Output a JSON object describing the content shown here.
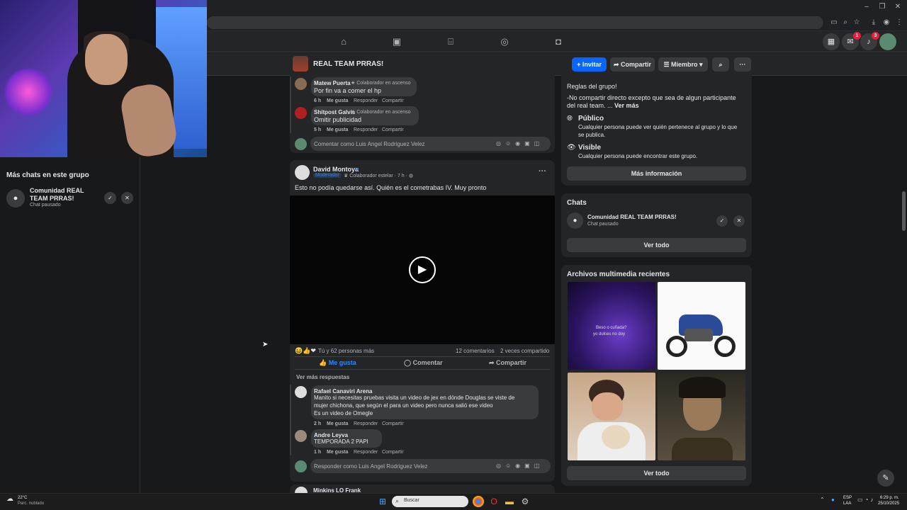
{
  "group": {
    "name": "REAL TEAM PRRAS!",
    "invite": "Invitar",
    "share": "Compartir",
    "member": "Miembro"
  },
  "badges": {
    "messenger": "1",
    "notifications": "3"
  },
  "sidebar": {
    "title": "Más chats en este grupo",
    "chat_name": "Comunidad REAL TEAM PRRAS!",
    "chat_status": "Chat pausado"
  },
  "comments_top": [
    {
      "name": "Matew Puerta",
      "role": "Colaborador en ascenso",
      "text": "Por fin va a comer el hp",
      "time": "6 h",
      "like": "Me gusta",
      "reply": "Responder",
      "share": "Compartir"
    },
    {
      "name": "Shitpost Galvis",
      "role": "Colaborador en ascenso",
      "text": "Omitir publicidad",
      "time": "5 h",
      "like": "Me gusta",
      "reply": "Responder",
      "share": "Compartir"
    }
  ],
  "comment_input_1": "Comentar como Luis Angel Rodriguez Velez",
  "post": {
    "author": "David Montoya",
    "mod": "Moderador",
    "role": "Colaborador estelar",
    "time": "7 h",
    "text": "Esto no podía quedarse así. Quién es el cometrabas IV. Muy pronto",
    "reactions": "Tú y 62 personas más",
    "comments": "12 comentarios",
    "shares": "2 veces compartido",
    "like": "Me gusta",
    "comment": "Comentar",
    "share": "Compartir",
    "more_replies": "Ver más respuestas"
  },
  "comments_bottom": [
    {
      "name": "Rafael Canaviri Arena",
      "line1": "Manito si necesitas pruebas visita un video de jex en dónde Douglas se viste de",
      "line2": "mujer chichona, que según el para un video pero nunca salió ese video",
      "line3": "Es un video de Omegle",
      "time": "2 h",
      "like": "Me gusta",
      "reply": "Responder",
      "share": "Compartir"
    },
    {
      "name": "Andre Leyva",
      "text": "TEMPORADA 2 PAPI",
      "time": "1 h",
      "like": "Me gusta",
      "reply": "Responder",
      "share": "Compartir"
    }
  ],
  "reply_input": "Responder como Luis Angel Rodriguez Velez",
  "next_post_author": "Minkins LO Frank",
  "about": {
    "rules_title": "Reglas del grupo!",
    "rules_text": "-No compartir directo excepto que sea de algun participante del real team. ...",
    "see_more": "Ver más",
    "public_title": "Público",
    "public_desc_1": "Cualquier persona puede ver quién pertenece al grupo y lo que",
    "public_desc_2": "se publica.",
    "visible_title": "Visible",
    "visible_desc": "Cualquier persona puede encontrar este grupo.",
    "more_info": "Más información"
  },
  "chats": {
    "title": "Chats",
    "name": "Comunidad REAL TEAM PRRAS!",
    "status": "Chat pausado",
    "see_all": "Ver todo"
  },
  "media": {
    "title": "Archivos multimedia recientes",
    "caption_1": "Beso o cuñada?",
    "caption_2": "yo dulces no doy",
    "see_all": "Ver todo"
  },
  "taskbar": {
    "temp": "22°C",
    "weather": "Parc. nublado",
    "search": "Buscar",
    "lang1": "ESP",
    "lang2": "LAA",
    "time": "6:29 p. m.",
    "date": "25/10/2025"
  }
}
